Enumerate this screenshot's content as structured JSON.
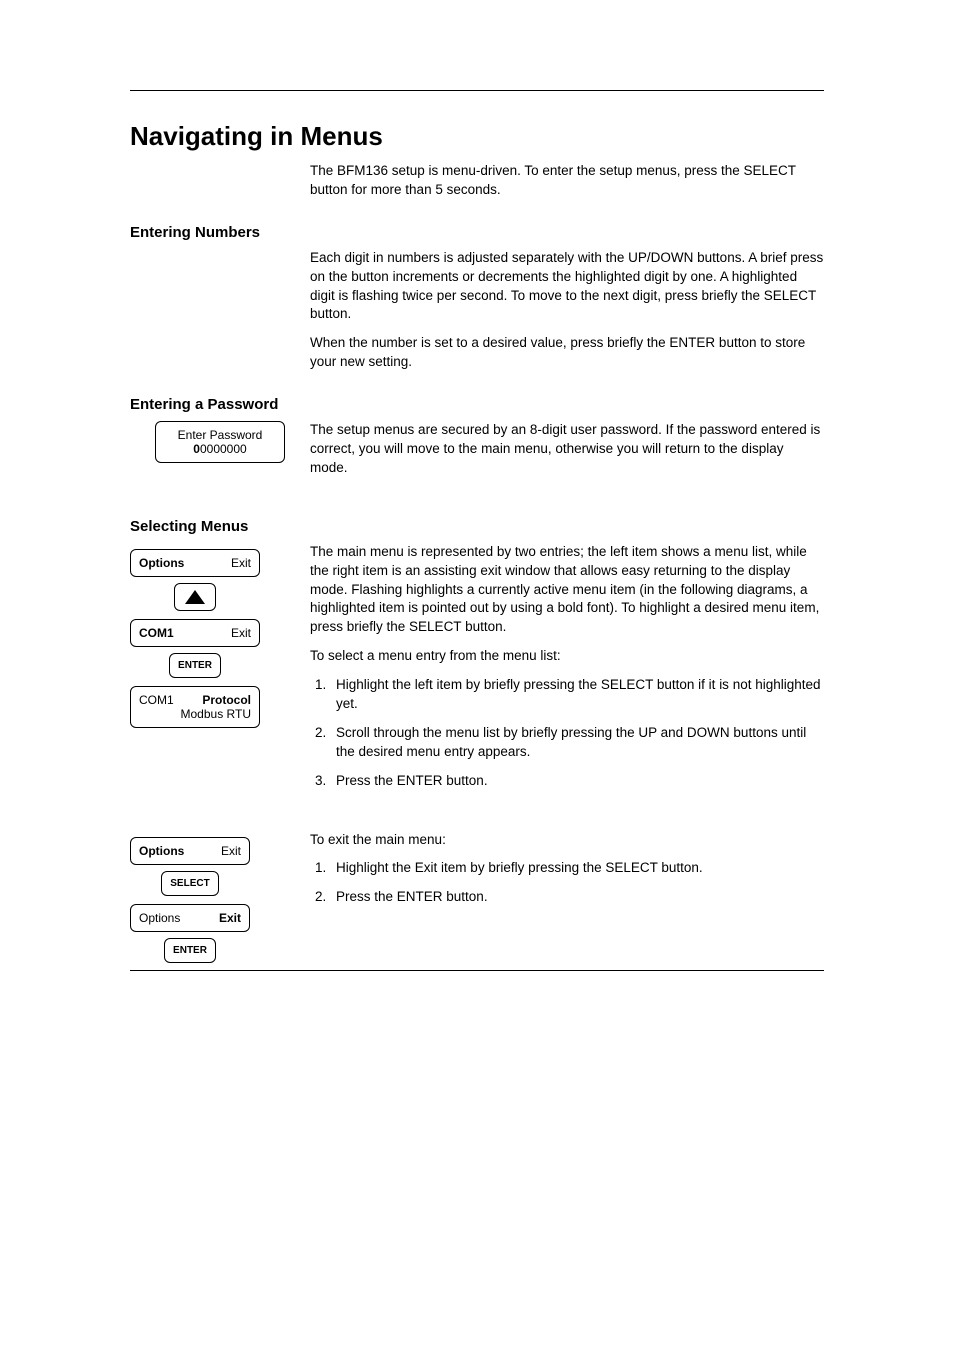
{
  "header_rule": true,
  "section_title": "Navigating in Menus",
  "intro_para": "The BFM136 setup is menu-driven. To enter the setup menus, press the SELECT button for more than 5 seconds.",
  "headings": {
    "numbers": "Entering Numbers",
    "password": "Entering a Password",
    "select_menus": "Selecting Menus"
  },
  "numbers": {
    "para1": "Each digit in numbers is adjusted separately with the UP/DOWN buttons. A brief press on the button increments or decrements the highlighted digit by one. A highlighted digit is flashing twice per second. To move to the next digit, press briefly the SELECT button.",
    "para2": "When the number is set to a desired value, press briefly the ENTER button to store your new setting."
  },
  "password": {
    "para": "The setup menus are secured by an 8-digit user password. If the password entered is correct, you will move to the main menu, otherwise you will return to the display mode.",
    "lcd_line1": "Enter Password",
    "lcd_digit_highlight": "0",
    "lcd_digits_rest": "0000000"
  },
  "select_menus": {
    "para1": "The main menu is represented by two entries; the left item shows a menu list, while the right item is an assisting exit window that allows easy returning to the display mode. Flashing highlights a currently active menu item (in the following diagrams, a highlighted item is pointed out by using a bold font). To highlight a desired menu item, press briefly the SELECT button.",
    "lead": "To select a menu entry from the menu list:",
    "steps": [
      "Highlight the left item by briefly pressing the SELECT button if it is not highlighted yet.",
      "Scroll through the menu list by briefly pressing the UP and DOWN buttons until the desired menu entry appears.",
      "Press the ENTER button."
    ],
    "flow1": {
      "box1_left": "Options",
      "box1_right": "Exit",
      "btn1_icon": "up-triangle",
      "box2_left": "COM1",
      "box2_right": "Exit",
      "btn2_label": "ENTER",
      "box3_left": "COM1",
      "box3_right": "Protocol",
      "box3_line2": "Modbus RTU"
    },
    "exit_lead": "To exit the main menu:",
    "exit_steps": [
      "Highlight the Exit item by briefly pressing the SELECT button.",
      "Press the ENTER button."
    ],
    "flow2": {
      "box1_left": "Options",
      "box1_right": "Exit",
      "btn1_label": "SELECT",
      "box2_left": "Options",
      "box2_right": "Exit",
      "btn2_label": "ENTER"
    }
  }
}
